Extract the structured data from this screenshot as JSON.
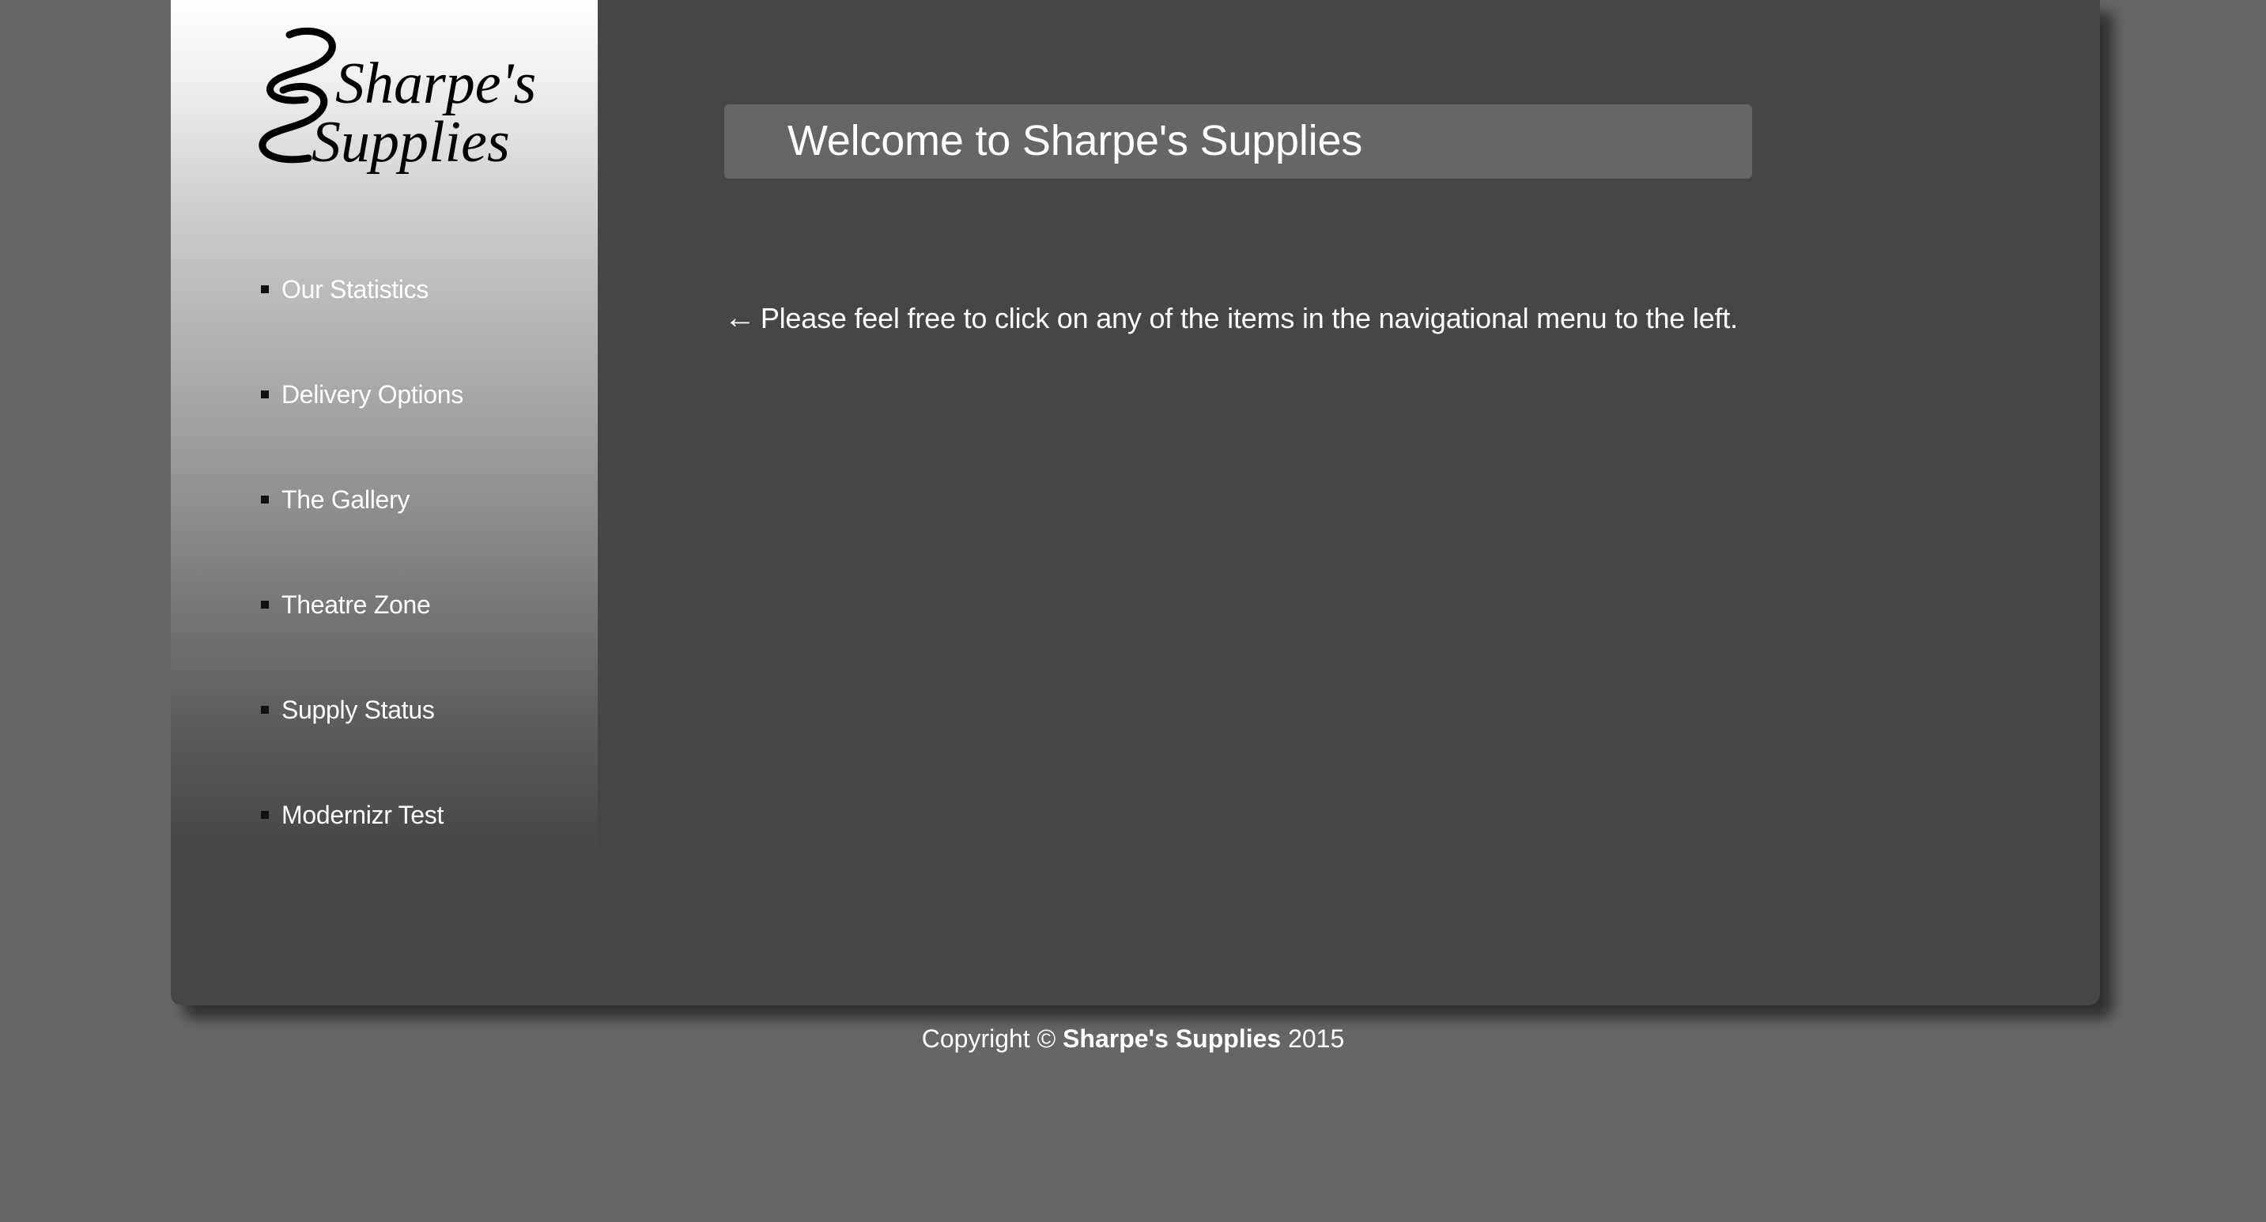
{
  "site": {
    "logo_line1": "Sharpe's",
    "logo_line2": "Supplies"
  },
  "nav": {
    "items": [
      {
        "label": "Our Statistics"
      },
      {
        "label": "Delivery Options"
      },
      {
        "label": "The Gallery"
      },
      {
        "label": "Theatre Zone"
      },
      {
        "label": "Supply Status"
      },
      {
        "label": "Modernizr Test"
      }
    ]
  },
  "main": {
    "welcome_title": "Welcome to Sharpe's Supplies",
    "intro_arrow": "←",
    "intro_text": "Please feel free to click on any of the items in the navigational menu to the left."
  },
  "footer": {
    "prefix": "Copyright ©",
    "brand": "Sharpe's Supplies",
    "year": "2015"
  },
  "colors": {
    "page_background": "#666666",
    "content_background": "#464646",
    "welcome_box": "#666666",
    "text": "#ffffff"
  }
}
